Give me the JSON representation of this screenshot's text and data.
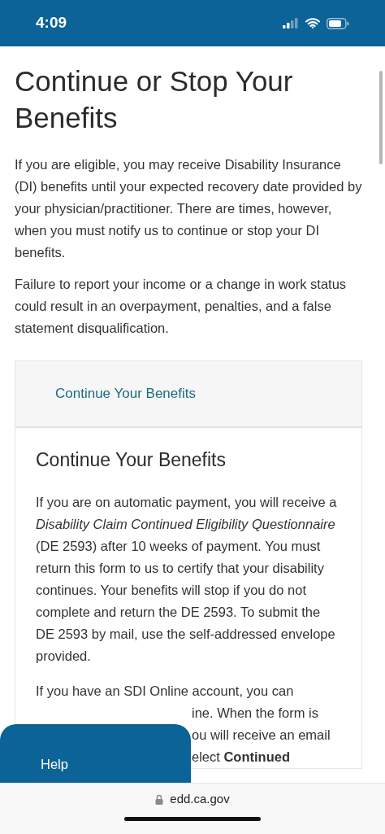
{
  "status_bar": {
    "time": "4:09"
  },
  "page": {
    "title": "Continue or Stop Your Benefits",
    "paragraphs": [
      "If you are eligible, you may receive Disability Insurance (DI) benefits until your expected recovery date provided by your physician/practitioner. There are times, however, when you must notify us to continue or stop your DI benefits.",
      "Failure to report your income or a change in work status could result in an overpayment, penalties, and a false statement disqualification."
    ]
  },
  "accordion": {
    "header_link": "Continue Your Benefits",
    "heading": "Continue Your Benefits",
    "body_paragraph": "If you are on automatic payment, you will receive a *Disability Claim Continued Eligibility Questionnaire* (DE 2593) after 10 weeks of payment. You must return this form to us to certify that your disability continues. Your benefits will stop if you do not complete and return the DE 2593. To submit the DE 2593 by mail, use the self-addressed envelope provided.",
    "partial_first_line": "If you have an SDI Online account, you can",
    "partial_fragments": [
      "ine. When the form is",
      "ou will receive an email",
      "elect **Continued**"
    ]
  },
  "help_panel": {
    "label": "Help"
  },
  "browser_bar": {
    "url": "edd.ca.gov"
  }
}
